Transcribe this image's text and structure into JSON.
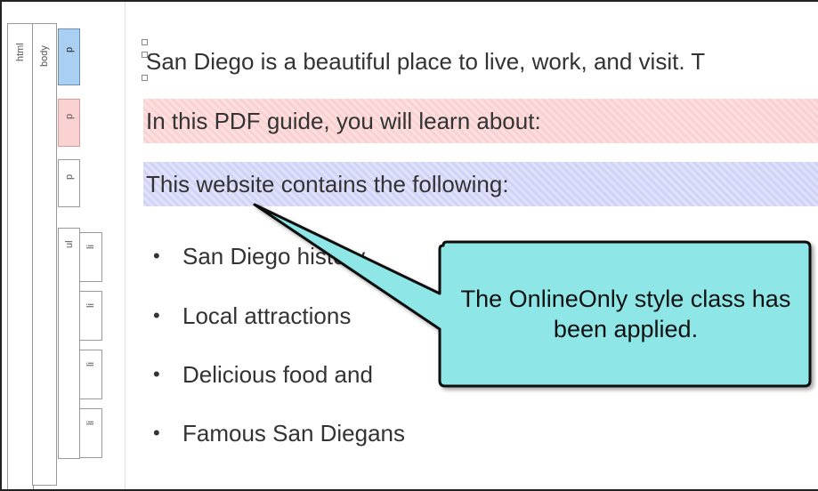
{
  "structure_bar": {
    "html_label": "html",
    "body_label": "body",
    "p_label": "p",
    "ul_label": "ul",
    "li_label": "li"
  },
  "content": {
    "paragraph_1": "San Diego is a beautiful place to live, work, and visit. T",
    "paragraph_2": "In this PDF guide, you will learn about:",
    "paragraph_3": "This website contains the following:",
    "list_items": [
      "San Diego history",
      "Local attractions",
      "Delicious food and",
      "Famous San Diegans"
    ]
  },
  "callout": {
    "text": "The OnlineOnly style class has been applied."
  },
  "colors": {
    "pdf_only_highlight": "#fbd0d0",
    "online_only_highlight": "#d0d3f7",
    "callout_fill": "#8ee6e6",
    "selected_tag": "#a9cff3"
  }
}
